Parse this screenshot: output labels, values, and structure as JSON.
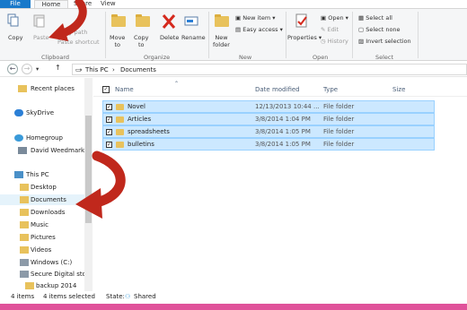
{
  "ribbon_tabs": [
    "File",
    "Home",
    "Share",
    "View"
  ],
  "clipboard": {
    "copy": "Copy",
    "paste": "Paste",
    "copy_path": "Copy path",
    "paste_shortcut": "Paste shortcut",
    "label": "Clipboard"
  },
  "organize": {
    "move_to": "Move",
    "move_to_2": "to",
    "copy_to": "Copy",
    "copy_to_2": "to",
    "delete": "Delete",
    "rename": "Rename",
    "label": "Organize"
  },
  "new": {
    "new_folder": "New",
    "new_folder_2": "folder",
    "new_item": "New item",
    "easy_access": "Easy access",
    "label": "New"
  },
  "open": {
    "properties": "Properties",
    "open": "Open",
    "edit": "Edit",
    "history": "History",
    "label": "Open"
  },
  "select": {
    "select_all": "Select all",
    "select_none": "Select none",
    "invert": "Invert selection",
    "label": "Select"
  },
  "address": {
    "this_pc": "This PC",
    "documents": "Documents"
  },
  "nav": [
    "Recent places",
    "SkyDrive",
    "Homegroup",
    "David Weedmark",
    "This PC",
    "Desktop",
    "Documents",
    "Downloads",
    "Music",
    "Pictures",
    "Videos",
    "Windows (C:)",
    "Secure Digital sto",
    "backup 2014"
  ],
  "columns": {
    "name": "Name",
    "date": "Date modified",
    "type": "Type",
    "size": "Size"
  },
  "files": [
    {
      "name": "Novel",
      "date": "12/13/2013 10:44 ...",
      "type": "File folder"
    },
    {
      "name": "Articles",
      "date": "3/8/2014 1:04 PM",
      "type": "File folder"
    },
    {
      "name": "spreadsheets",
      "date": "3/8/2014 1:05 PM",
      "type": "File folder"
    },
    {
      "name": "bulletins",
      "date": "3/8/2014 1:05 PM",
      "type": "File folder"
    }
  ],
  "status": {
    "items": "4 items",
    "selected": "4 items selected",
    "state_label": "State:",
    "state_value": "Shared"
  },
  "colors": {
    "accent": "#1979ca",
    "selection": "#cce8ff",
    "arrow": "#d52a1e",
    "footer": "#e0529a"
  }
}
